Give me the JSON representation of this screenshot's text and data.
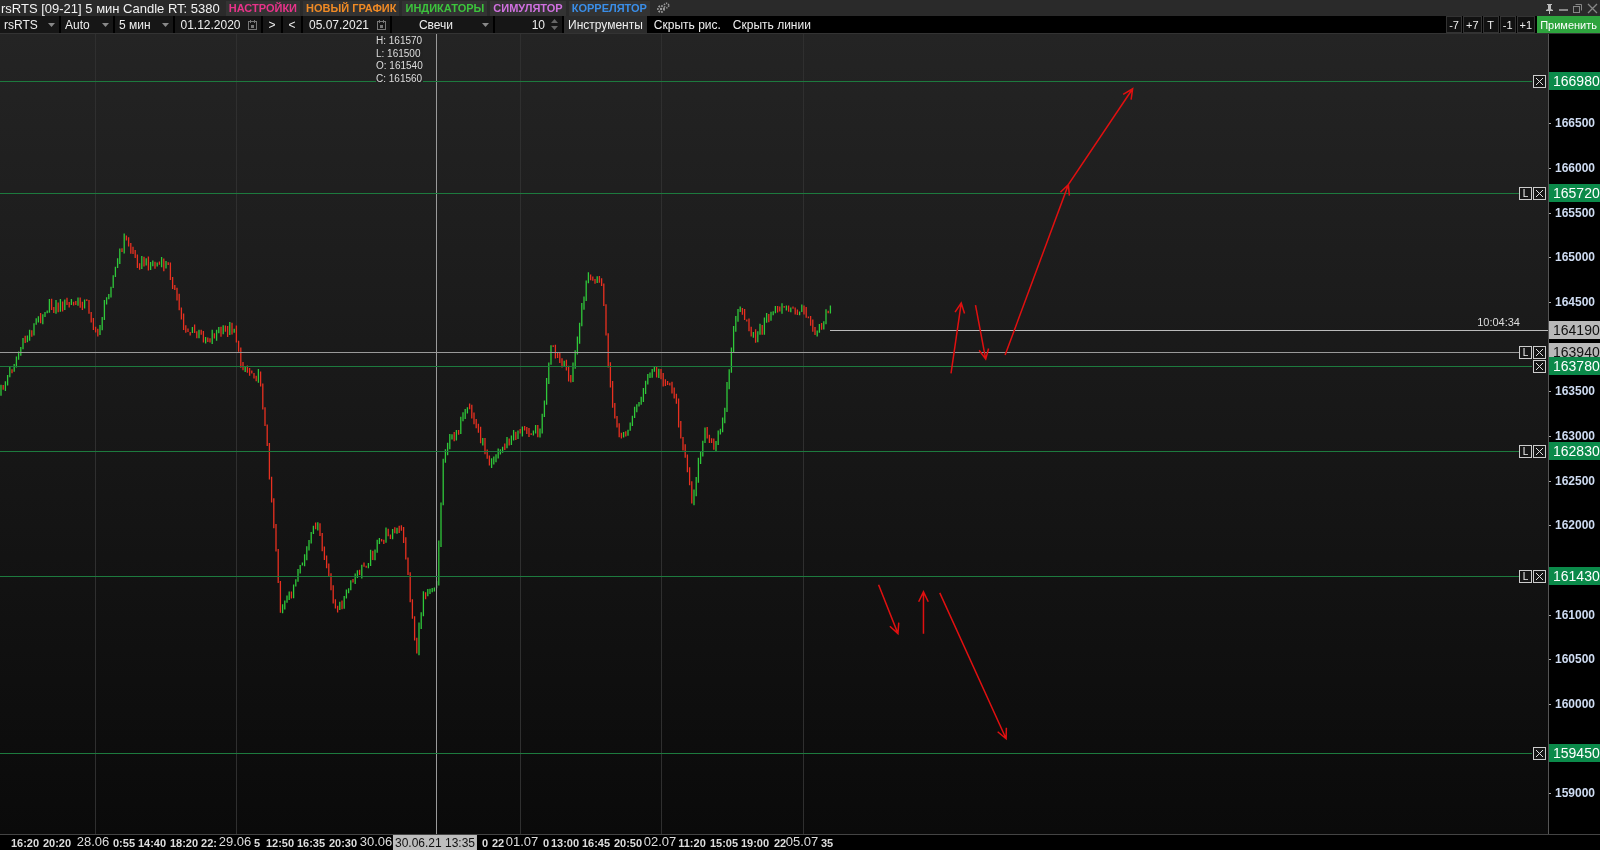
{
  "window": {
    "title": "rsRTS [09-21] 5 мин Candle RT: 5380"
  },
  "menu": [
    {
      "label": "НАСТРОЙКИ",
      "color": "#e8338a"
    },
    {
      "label": "НОВЫЙ ГРАФИК",
      "color": "#f08a24"
    },
    {
      "label": "ИНДИКАТОРЫ",
      "color": "#3cc43c"
    },
    {
      "label": "СИМУЛЯТОР",
      "color": "#d070e0"
    },
    {
      "label": "КОРРЕЛЯТОР",
      "color": "#3a8ee8"
    }
  ],
  "toolbar": [
    {
      "kind": "dropdown",
      "value": "rsRTS"
    },
    {
      "kind": "dropdown",
      "value": "Auto"
    },
    {
      "kind": "dropdown",
      "value": "5 мин"
    },
    {
      "kind": "date",
      "value": "01.12.2020"
    },
    {
      "kind": "nav",
      "value": ">"
    },
    {
      "kind": "nav",
      "value": "<"
    },
    {
      "kind": "date",
      "value": "05.07.2021"
    },
    {
      "kind": "dropdown",
      "value": "Свечи"
    },
    {
      "kind": "spinner",
      "value": "10"
    },
    {
      "kind": "button",
      "value": "Инструменты"
    },
    {
      "kind": "link",
      "value": "Скрыть рис."
    },
    {
      "kind": "link",
      "value": "Скрыть линии"
    }
  ],
  "step_buttons": [
    "-7",
    "+7",
    "T",
    "-1",
    "+1"
  ],
  "apply_button": "Применить",
  "chart": {
    "ohlc": [
      "H: 161570",
      "L: 161500",
      "O: 161540",
      "C: 161560"
    ],
    "price_ticks": [
      "166500",
      "166000",
      "165500",
      "165000",
      "164500",
      "163500",
      "163000",
      "162500",
      "162000",
      "161000",
      "160500",
      "160000",
      "159000"
    ],
    "levels": [
      {
        "kind": "level",
        "price": "166980"
      },
      {
        "kind": "level",
        "price": "165720",
        "lock": "L"
      },
      {
        "kind": "marker",
        "price": "163940",
        "lock": "L"
      },
      {
        "kind": "level",
        "price": "163780"
      },
      {
        "kind": "level",
        "price": "162830",
        "lock": "L"
      },
      {
        "kind": "level",
        "price": "161430",
        "lock": "L"
      },
      {
        "kind": "level",
        "price": "159450"
      }
    ],
    "last_price": {
      "price": "164190",
      "time": "10:04:34"
    },
    "time_labels": [
      {
        "kind": "time",
        "text": "16:20"
      },
      {
        "kind": "time",
        "text": "20:20"
      },
      {
        "kind": "date",
        "text": "28.06"
      },
      {
        "kind": "time",
        "text": "0:55"
      },
      {
        "kind": "time",
        "text": "14:40"
      },
      {
        "kind": "time",
        "text": "18:20"
      },
      {
        "kind": "time",
        "text": "22:"
      },
      {
        "kind": "date",
        "text": "29.06"
      },
      {
        "kind": "time",
        "text": "5"
      },
      {
        "kind": "time",
        "text": "12:50"
      },
      {
        "kind": "time",
        "text": "16:35"
      },
      {
        "kind": "time",
        "text": "20:30"
      },
      {
        "kind": "date",
        "text": "30.06"
      },
      {
        "kind": "cursor",
        "text": "30.06.21 13:35"
      },
      {
        "kind": "time",
        "text": "0"
      },
      {
        "kind": "time",
        "text": "22"
      },
      {
        "kind": "date",
        "text": "01.07"
      },
      {
        "kind": "time",
        "text": "0"
      },
      {
        "kind": "time",
        "text": "13:00"
      },
      {
        "kind": "time",
        "text": "16:45"
      },
      {
        "kind": "time",
        "text": "20:50"
      },
      {
        "kind": "date",
        "text": "02.07"
      },
      {
        "kind": "time",
        "text": "11:20"
      },
      {
        "kind": "time",
        "text": "15:05"
      },
      {
        "kind": "time",
        "text": "19:00"
      },
      {
        "kind": "time",
        "text": "22"
      },
      {
        "kind": "date",
        "text": "05.07"
      },
      {
        "kind": "time",
        "text": "35"
      }
    ]
  }
}
